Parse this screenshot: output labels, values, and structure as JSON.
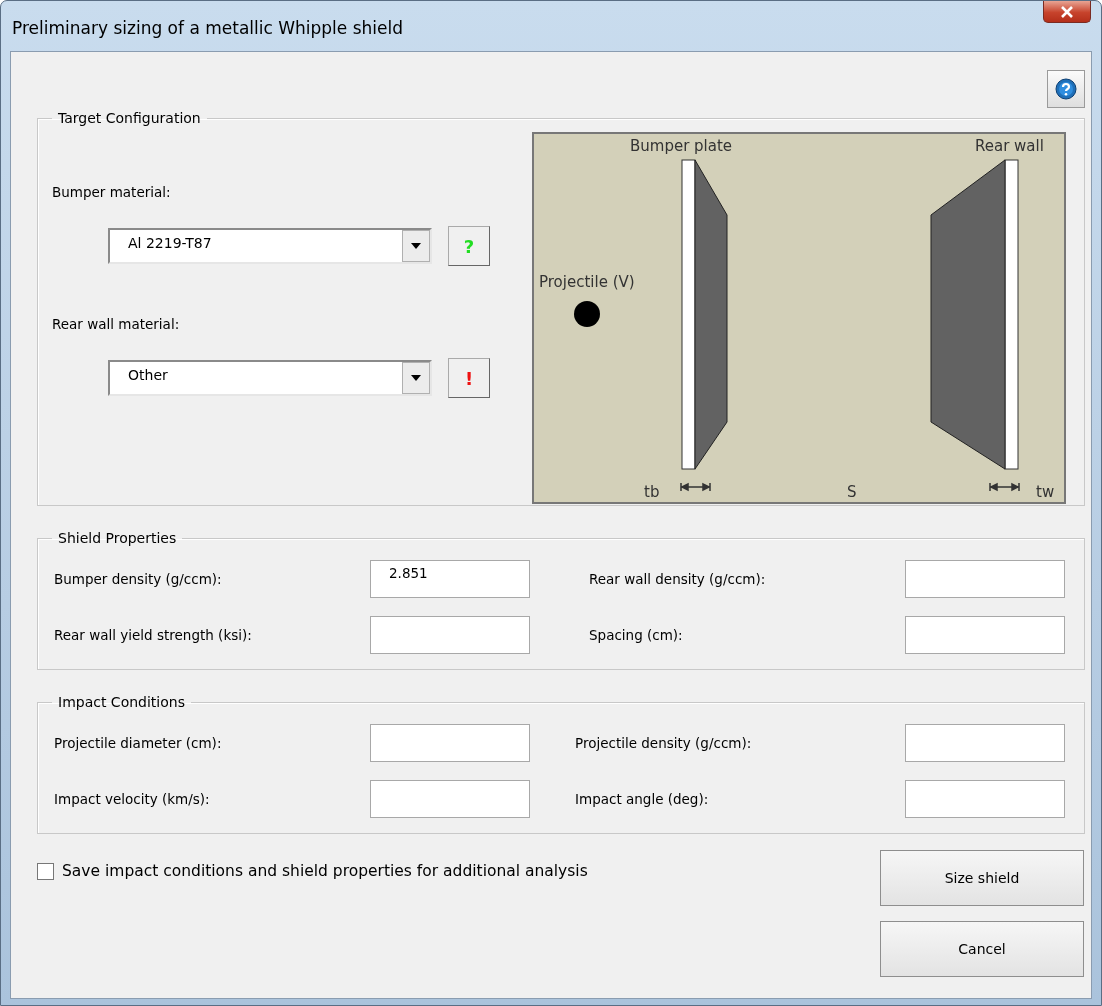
{
  "window": {
    "title": "Preliminary sizing of a metallic Whipple shield"
  },
  "target_configuration": {
    "title": "Target Configuration",
    "materials": [
      {
        "label": "Bumper material:",
        "value": "Al 2219-T87",
        "info": "?",
        "color": "#22dd22"
      },
      {
        "label": "Rear wall material:",
        "value": "Other",
        "info": "!",
        "color": "#ee1111"
      }
    ],
    "diagram": {
      "bumper_label": "Bumper plate",
      "rear_label": "Rear wall",
      "projectile_label": "Projectile (V)",
      "tb_label": "tb",
      "s_label": "S",
      "tw_label": "tw"
    }
  },
  "shield_properties": {
    "title": "Shield Properties",
    "fields": [
      {
        "label": "Bumper density (g/ccm):",
        "value": "2.851"
      },
      {
        "label": "Rear wall density (g/ccm):"
      },
      {
        "label": "Rear wall yield strength (ksi):"
      },
      {
        "label": "Spacing (cm):"
      }
    ]
  },
  "impact_conditions": {
    "title": "Impact Conditions",
    "fields": [
      {
        "label": "Projectile diameter (cm):"
      },
      {
        "label": "Projectile density (g/ccm):"
      },
      {
        "label": "Impact velocity (km/s):"
      },
      {
        "label": "Impact angle (deg):"
      }
    ]
  },
  "save_option": {
    "label": "Save impact conditions and shield properties for additional analysis",
    "checked": false
  },
  "buttons": [
    "Size shield",
    "Cancel"
  ]
}
